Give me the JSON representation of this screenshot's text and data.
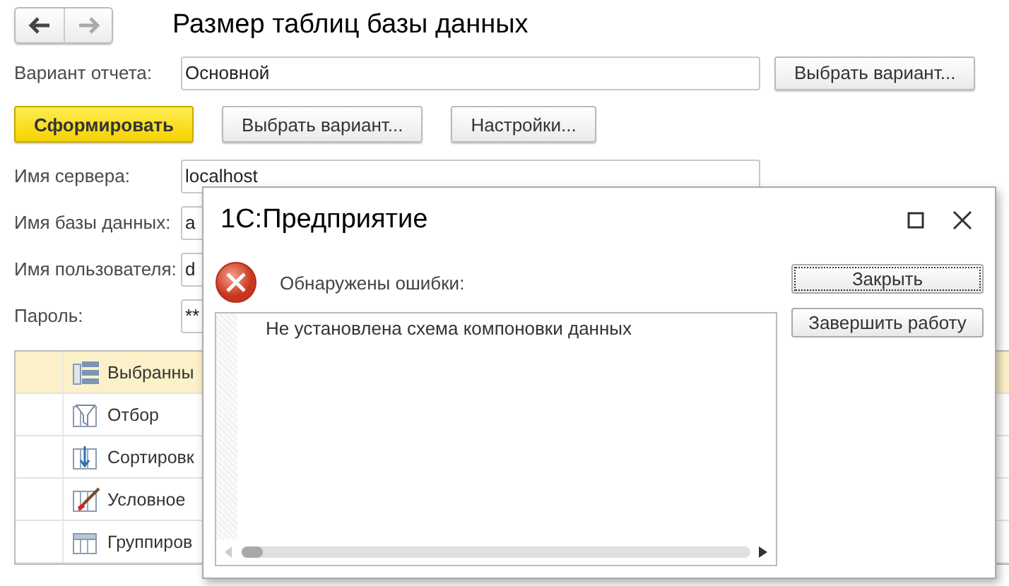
{
  "nav": [
    {
      "kind": "back",
      "disabled": false
    },
    {
      "kind": "forward",
      "disabled": true
    }
  ],
  "title": "Размер таблиц базы данных",
  "variant": {
    "label": "Вариант отчета:",
    "value": "Основной",
    "button": "Выбрать вариант..."
  },
  "toolbar": [
    {
      "label": "Сформировать",
      "kind": "primary"
    },
    {
      "label": "Выбрать вариант...",
      "kind": "normal"
    },
    {
      "label": "Настройки...",
      "kind": "normal"
    }
  ],
  "fields": [
    {
      "label": "Имя сервера:",
      "value": "localhost"
    },
    {
      "label": "Имя базы данных:",
      "value": "a"
    },
    {
      "label": "Имя пользователя:",
      "value": "d"
    },
    {
      "label": "Пароль:",
      "value": "**"
    }
  ],
  "settings": [
    {
      "label": "Выбранны",
      "kind": "fields",
      "selected": true
    },
    {
      "label": "Отбор",
      "kind": "filter",
      "selected": false
    },
    {
      "label": "Сортировк",
      "kind": "sort",
      "selected": false
    },
    {
      "label": "Условное",
      "kind": "format",
      "selected": false
    },
    {
      "label": "Группиров",
      "kind": "grouping",
      "selected": false
    }
  ],
  "dialog": {
    "title": "1С:Предприятие",
    "message": "Обнаружены ошибки:",
    "details": "Не установлена схема компоновки данных",
    "buttons": [
      {
        "label": "Закрыть",
        "focused": true
      },
      {
        "label": "Завершить работу",
        "focused": false
      }
    ]
  }
}
